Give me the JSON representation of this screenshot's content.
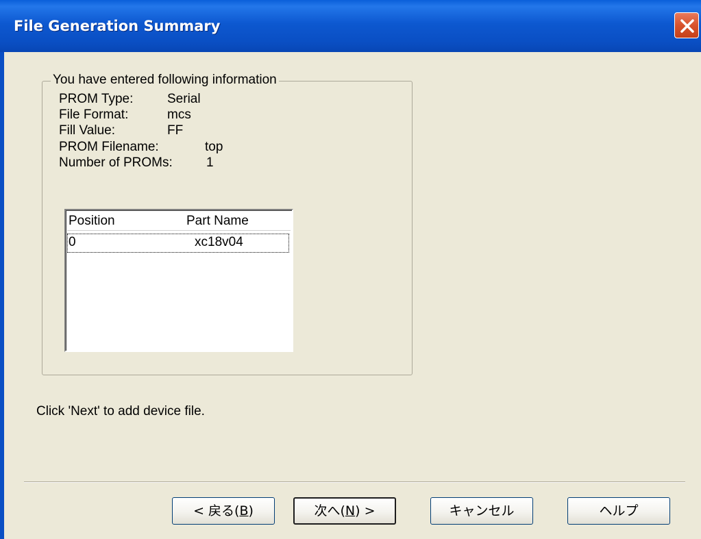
{
  "window": {
    "title": "File Generation Summary",
    "close_icon": "close-icon"
  },
  "summary": {
    "legend": "You have entered following information",
    "rows": [
      {
        "label": "PROM Type:",
        "value": "Serial"
      },
      {
        "label": "File Format:",
        "value": "mcs"
      },
      {
        "label": "Fill Value:",
        "value": "FF"
      },
      {
        "label": "PROM Filename:",
        "value": "top"
      },
      {
        "label": "Number of PROMs:",
        "value": "1"
      }
    ]
  },
  "list": {
    "columns": [
      "Position",
      "Part Name"
    ],
    "rows": [
      {
        "position": "0",
        "part_name": "xc18v04"
      }
    ]
  },
  "status_text": "Click 'Next' to add device file.",
  "buttons": {
    "back": {
      "pre": "< 戻る(",
      "key": "B",
      "post": ")"
    },
    "next": {
      "pre": "次へ(",
      "key": "N",
      "post": ") >"
    },
    "cancel": "キャンセル",
    "help": "ヘルプ"
  },
  "colors": {
    "titlebar": "#0a4fc4",
    "dialog_bg": "#ece9d8",
    "close_button": "#d8532c"
  }
}
